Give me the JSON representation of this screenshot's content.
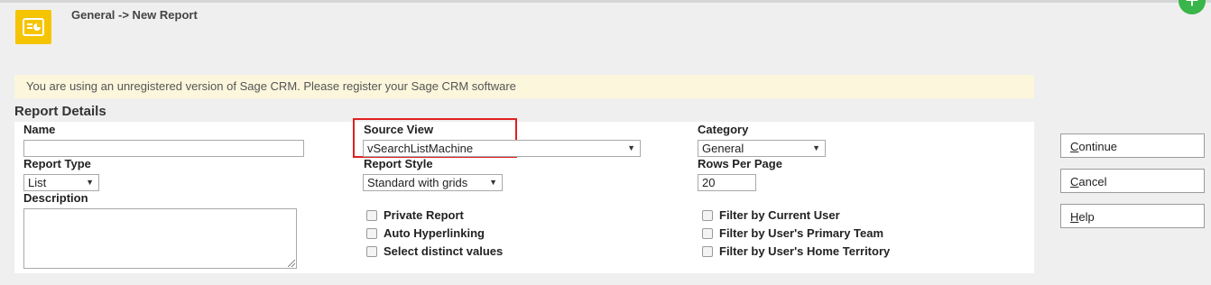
{
  "header": {
    "breadcrumb": "General -> New Report",
    "app_icon": "report-icon",
    "plus_icon": "plus-icon"
  },
  "notice": {
    "text": "You are using an unregistered version of Sage CRM. Please register your Sage CRM software"
  },
  "section": {
    "title": "Report Details"
  },
  "form": {
    "name": {
      "label": "Name",
      "value": ""
    },
    "source_view": {
      "label": "Source View",
      "value": "vSearchListMachine"
    },
    "category": {
      "label": "Category",
      "value": "General"
    },
    "report_type": {
      "label": "Report Type",
      "value": "List"
    },
    "report_style": {
      "label": "Report Style",
      "value": "Standard with grids"
    },
    "rows_per_page": {
      "label": "Rows Per Page",
      "value": "20"
    },
    "description": {
      "label": "Description",
      "value": ""
    },
    "checkboxes_left": [
      {
        "label": "Private Report",
        "checked": false
      },
      {
        "label": "Auto Hyperlinking",
        "checked": false
      },
      {
        "label": "Select distinct values",
        "checked": false
      }
    ],
    "checkboxes_right": [
      {
        "label": "Filter by Current User",
        "checked": false
      },
      {
        "label": "Filter by User's Primary Team",
        "checked": false
      },
      {
        "label": "Filter by User's Home Territory",
        "checked": false
      }
    ]
  },
  "actions": {
    "continue_first": "C",
    "continue_rest": "ontinue",
    "cancel_first": "C",
    "cancel_rest": "ancel",
    "help_first": "H",
    "help_rest": "elp"
  },
  "colors": {
    "accent": "#f5c400",
    "highlight_box": "#e02020",
    "notice_bg": "#fbf6dc"
  }
}
